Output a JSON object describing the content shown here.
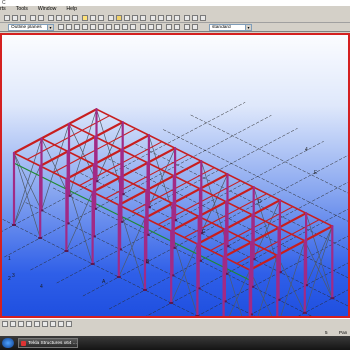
{
  "titlebar": {
    "title": "C"
  },
  "menu": {
    "items": [
      "rts",
      "Tools",
      "Window",
      "Help"
    ]
  },
  "toolbar": {
    "view_dropdown": "Outline planes",
    "props_dropdown": "standard"
  },
  "viewport": {
    "grid_labels_left": [
      "1",
      "2",
      "3",
      "4"
    ],
    "grid_labels_right": [
      "A",
      "B",
      "C",
      "D",
      "E"
    ],
    "grid_label_top_right": "4"
  },
  "statusbar": {
    "page_number": "5",
    "mode_text": "Pan"
  },
  "taskbar": {
    "item_label": "Tekla Structures x64 ..."
  },
  "colors": {
    "columns": "#a12a86",
    "beams": "#c81e1e",
    "bracing": "#4e5a6a",
    "ties": "#1f8a2f",
    "frame": "#d42020",
    "sky_top": "#fbfcff",
    "sky_bottom": "#1f4fe0"
  }
}
